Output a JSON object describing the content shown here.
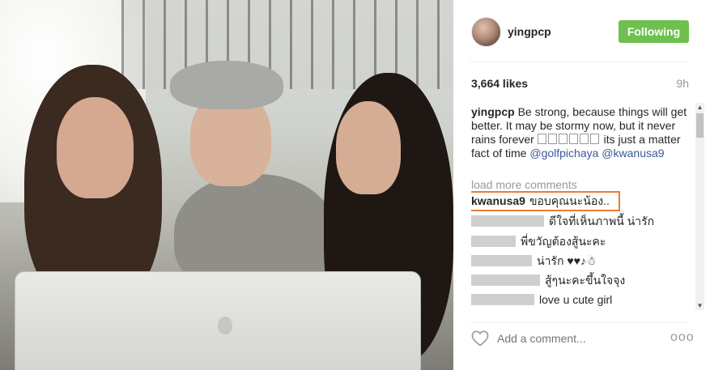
{
  "post": {
    "username": "yingpcp",
    "follow_label": "Following",
    "likes": "3,664 likes",
    "time": "9h",
    "caption": {
      "username": "yingpcp",
      "text_1": "Be strong, because things will get better. It may be stormy now, but it never rains forever",
      "text_2": "its just a matter fact of time",
      "mention_1": "@golfpichaya",
      "mention_2": "@kwanusa9"
    },
    "load_more": "load more comments",
    "comments": [
      {
        "username": "kwanusa9",
        "text": "ขอบคุณนะน้อง.."
      },
      {
        "username": "",
        "text": "ดีใจที่เห็นภาพนี้ น่ารัก"
      },
      {
        "username": "",
        "text": "พี่ขวัญต้องสู้นะคะ"
      },
      {
        "username": "",
        "text": "น่ารัก ♥♥♪☃"
      },
      {
        "username": "",
        "text": "สู้ๆนะคะขึ้นใจจุง"
      },
      {
        "username": "",
        "text": "love u cute girl"
      }
    ],
    "add_comment_placeholder": "Add a comment...",
    "more_label": "ooo"
  },
  "colors": {
    "following": "#70c050",
    "mention": "#3b5998",
    "highlight": "#ec7d2e"
  },
  "icons": {
    "heart": "heart-outline-icon",
    "more": "more-options-icon"
  }
}
